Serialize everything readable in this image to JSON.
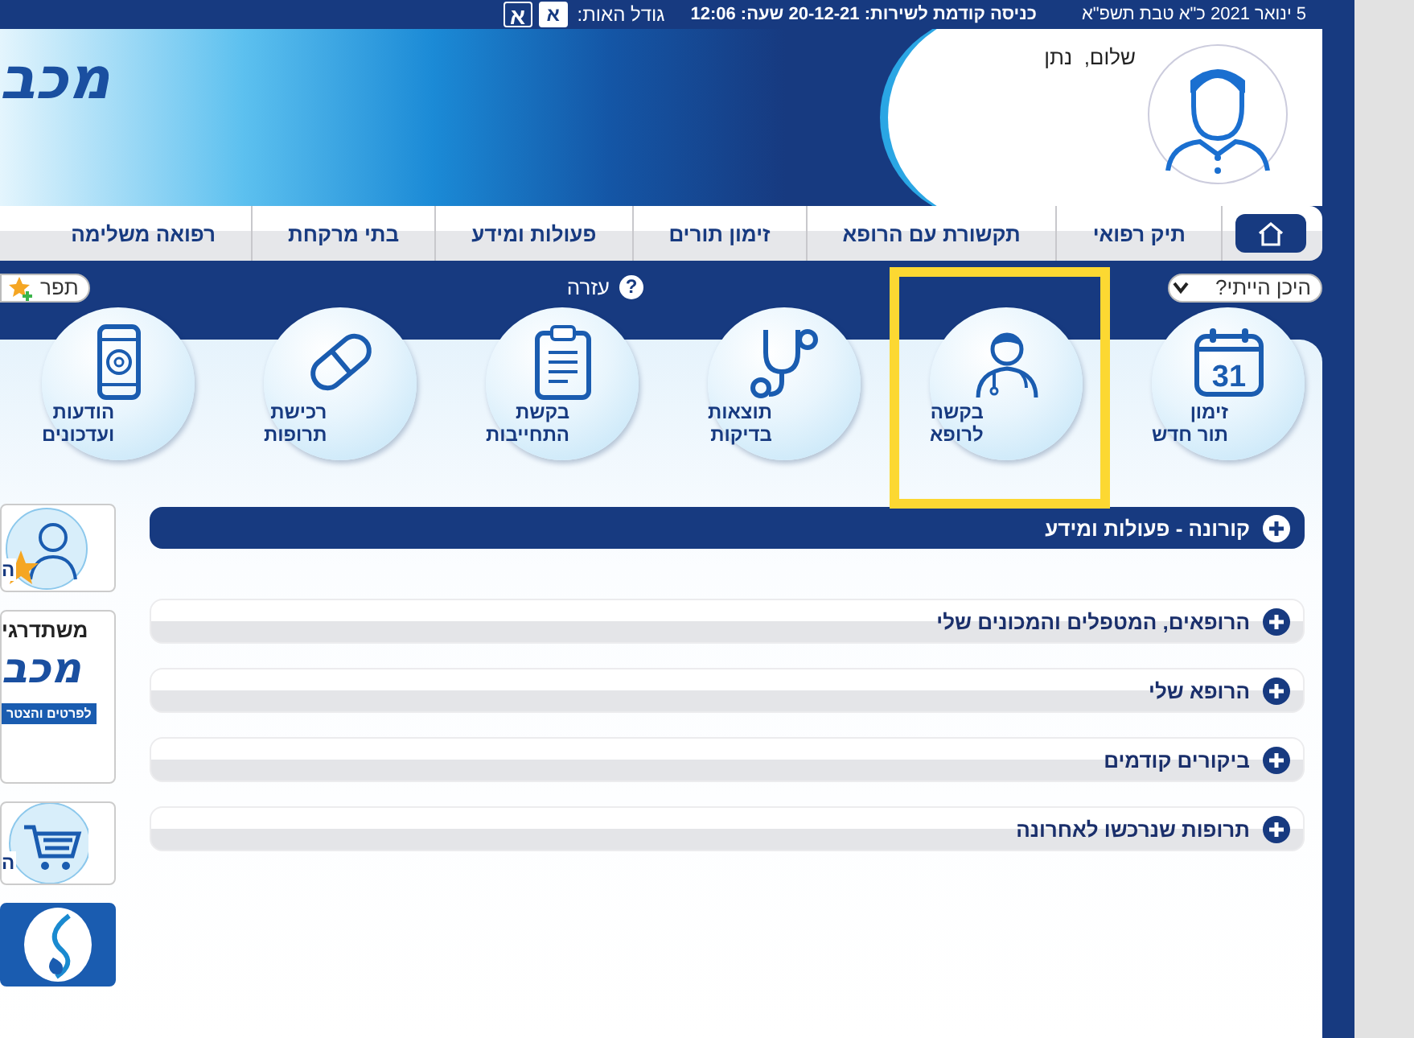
{
  "top_bar": {
    "date": "5 ינואר 2021 כ\"א טבת תשפ\"א",
    "last_login": "כניסה קודמת לשירות: 20-12-21 שעה: 12:06",
    "font_size_label": "גודל האות:",
    "font_size_buttons": [
      {
        "label": "א",
        "selected": true
      },
      {
        "label": "א",
        "selected": false
      }
    ]
  },
  "header": {
    "logo_text": "מכב",
    "greeting": "שלום,  נתן"
  },
  "nav": {
    "home": {
      "selected": true
    },
    "items": [
      {
        "label": "תיק רפואי",
        "selected": false
      },
      {
        "label": "תקשורת עם הרופא",
        "selected": false
      },
      {
        "label": "זימון תורים",
        "selected": false
      },
      {
        "label": "פעולות ומידע",
        "selected": false
      },
      {
        "label": "בתי מרקחת",
        "selected": false
      },
      {
        "label": "רפואה משלימה",
        "selected": false
      }
    ]
  },
  "toolbar": {
    "where_was_i": "היכן הייתי?",
    "help": "עזרה",
    "help_icon": "?",
    "favorites": "תפר"
  },
  "tiles": [
    {
      "kind": "calendar",
      "icon_text": "31",
      "label": "זימון\nתור חדש",
      "highlighted": false
    },
    {
      "kind": "doctor",
      "label": "בקשה\nלרופא",
      "highlighted": true
    },
    {
      "kind": "stethoscope",
      "label": "תוצאות\nבדיקות",
      "highlighted": false
    },
    {
      "kind": "clipboard",
      "label": "בקשת\nהתחייבות",
      "highlighted": false
    },
    {
      "kind": "pill",
      "label": "רכישת\nתרופות",
      "highlighted": false
    },
    {
      "kind": "phone",
      "label": "הודעות\nועדכונים",
      "highlighted": false
    }
  ],
  "sidebar": [
    {
      "kind": "doctor",
      "text": "ה"
    },
    {
      "kind": "promo",
      "title": "משתדרגי",
      "logo": "מכב",
      "banner": "לפרטים והצטר"
    },
    {
      "kind": "cart",
      "text": "ה"
    },
    {
      "kind": "dna"
    }
  ],
  "accordion": [
    {
      "label": "קורונה - פעולות ומידע",
      "kind": "featured",
      "expanded": false
    },
    {
      "label": "הרופאים, המטפלים והמכונים שלי",
      "kind": "plain",
      "expanded": false
    },
    {
      "label": "הרופא שלי",
      "kind": "plain",
      "expanded": false
    },
    {
      "label": "ביקורים קודמים",
      "kind": "plain",
      "expanded": false
    },
    {
      "label": "תרופות שנרכשו לאחרונה",
      "kind": "plain",
      "expanded": false
    }
  ]
}
